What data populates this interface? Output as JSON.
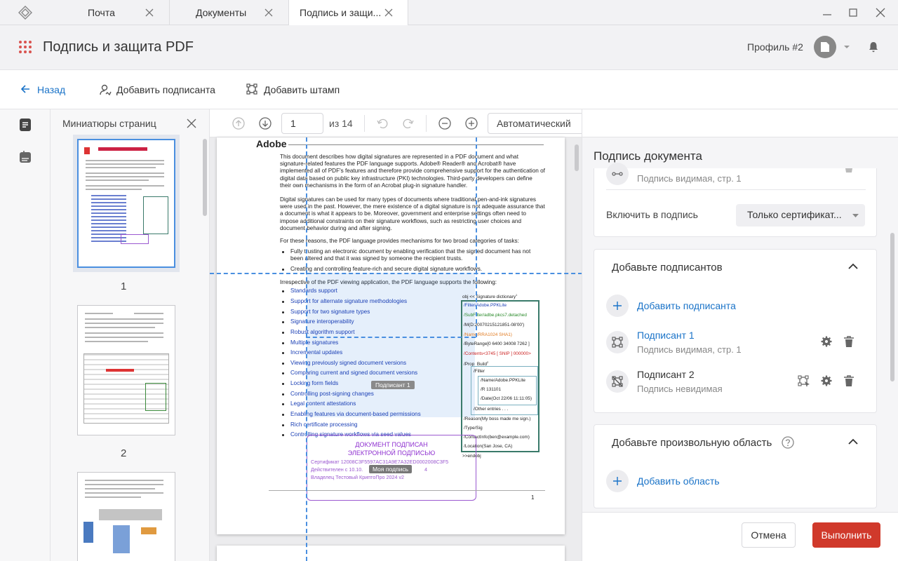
{
  "tabs": [
    {
      "label": "Почта"
    },
    {
      "label": "Документы"
    },
    {
      "label": "Подпись и защи..."
    }
  ],
  "header": {
    "title": "Подпись и защита PDF",
    "profile": "Профиль #2"
  },
  "toolbar": {
    "back": "Назад",
    "add_signer": "Добавить подписанта",
    "add_stamp": "Добавить штамп"
  },
  "thumbnails": {
    "title": "Миниатюры страниц",
    "pages": [
      "1",
      "2"
    ]
  },
  "viewer": {
    "page": "1",
    "of": "из 14",
    "zoom": "Автоматический"
  },
  "pdf": {
    "brand": "Adobe",
    "p1": "This document describes how digital signatures are represented in a PDF document and what signature-related features the PDF language supports. Adobe® Reader® and Acrobat® have implemented all of PDF's features and therefore provide comprehensive support for the authentication of digital data based on public key infrastructure (PKI) technologies. Third-party developers can define their own mechanisms in the form of an Acrobat plug-in signature handler.",
    "p2": "Digital signatures can be used for many types of documents where traditional pen-and-ink signatures were used in the past. However, the mere existence of a digital signature is not adequate assurance that a document is what it appears to be. Moreover, government and enterprise settings often need to impose additional constraints on their signature workflows, such as restricting user choices and document behavior during and after signing.",
    "p3": "For these reasons, the PDF language provides mechanisms for two broad categories of tasks:",
    "b1": "Fully trusting an electronic document by enabling verification that the signed document has not been altered and that it was signed by someone the recipient trusts.",
    "b2": "Creating and controlling feature-rich and secure digital signature workflows.",
    "p4": "Irrespective of the PDF viewing application, the PDF language supports the following:",
    "features": [
      "Standards support",
      "Support for alternate signature methodologies",
      "Support for two signature types",
      "Signature interoperability",
      "Robust algorithm support",
      "Multiple signatures",
      "Incremental updates",
      "Viewing previously signed document versions",
      "Comparing current and signed document versions",
      "Locking form fields",
      "Controlling post-signing changes",
      "Legal content attestations",
      "Enabling features via document-based permissions",
      "Rich certificate processing",
      "Controlling signature workflows via seed values"
    ],
    "sigdict": {
      "head": "obj << Signature dictionary",
      "sup": "1",
      "filter": "/Filter/Adobe.PPKLite",
      "subfilter": "/SubFilter/adbe.pkcs7.detached",
      "m": "/M(D:20070215121851-08'00')",
      "name": "/Name/RRA1024 SHA1)",
      "byterange": "/ByteRange[0 6400 34008 7262 ]",
      "contents": "/Contents<3745 [ SNIP ] 000000>",
      "prop": "/Prop_Build",
      "prop_sup": "2",
      "pfilter": "/Filter",
      "pname": "/Name/Adobe.PPKLite",
      "r": "/R 131101",
      "date": "/Date(Oct 22/06 11:11:05)",
      "other": "/Other entries . . .",
      "reason": "/Reason(My boss made me sign.)",
      "type": "/Type/Sig",
      "contact": "/ContactInfo(ben@example.com)",
      "location": "/Location(San Jose, CA)",
      "end": ">>endobj"
    },
    "stamp": {
      "line1": "ДОКУМЕНТ ПОДПИСАН",
      "line2": "ЭЛЕКТРОННОЙ ПОДПИСЬЮ",
      "cert": "Сертификат 12008C3F5597AC31A9E7A32ED0002008C3F5",
      "valid_a": "Действителен с 10.10.",
      "valid_b": "4",
      "owner": "Владелец Тестовый КриптоПро 2024 v2"
    },
    "label_signer1": "Подписант 1",
    "label_my": "Моя подпись",
    "page_no": "1"
  },
  "panel": {
    "title": "Подпись документа",
    "top_item_sub": "Подпись видимая, стр. 1",
    "include_label": "Включить в подпись",
    "include_value": "Только сертификат...",
    "signers_title": "Добавьте подписантов",
    "add_signer": "Добавить подписанта",
    "signers": [
      {
        "name": "Подписант 1",
        "sub": "Подпись видимая, стр. 1"
      },
      {
        "name": "Подписант 2",
        "sub": "Подпись невидимая"
      }
    ],
    "area_title": "Добавьте произвольную область",
    "add_area": "Добавить область",
    "cancel": "Отмена",
    "execute": "Выполнить"
  },
  "colors": {
    "accent": "#1a73c8",
    "primary_button": "#d0392b",
    "grid_line": "#4a8fe0"
  }
}
